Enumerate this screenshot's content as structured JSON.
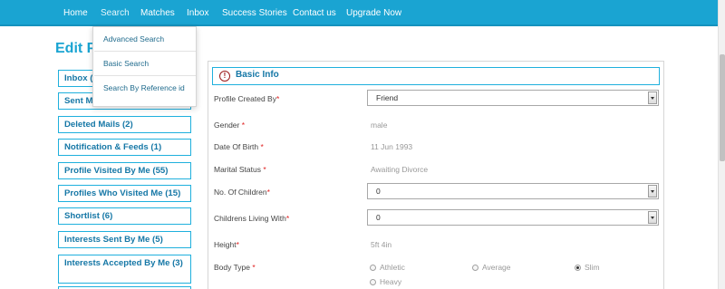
{
  "nav": {
    "items": [
      "Home",
      "Search",
      "Matches",
      "Inbox",
      "Success Stories",
      "Contact us",
      "Upgrade Now"
    ],
    "active_index": 1
  },
  "search_dropdown": {
    "items": [
      "Advanced Search",
      "Basic Search",
      "Search By Reference id"
    ]
  },
  "page": {
    "title": "Edit P"
  },
  "sidebar": {
    "items": [
      {
        "label": "Inbox ("
      },
      {
        "label": "Sent Mails (3)"
      },
      {
        "label": "Deleted Mails (2)"
      },
      {
        "label": "Notification & Feeds (1)"
      },
      {
        "label": "Profile Visited By Me (55)"
      },
      {
        "label": "Profiles Who Visited Me (15)"
      },
      {
        "label": "Shortlist (6)"
      },
      {
        "label": "Interests Sent By Me (5)"
      },
      {
        "label": "Interests Accepted By Me (3)"
      }
    ]
  },
  "basic_info": {
    "title": "Basic Info",
    "profile_created_by": {
      "label": "Profile Created By",
      "value": "Friend"
    },
    "gender": {
      "label": "Gender ",
      "value": "male"
    },
    "dob": {
      "label": "Date Of Birth ",
      "value": "11 Jun 1993"
    },
    "marital_status": {
      "label": "Marital Status ",
      "value": "Awaiting Divorce"
    },
    "children": {
      "label": "No. Of Children",
      "value": "0"
    },
    "children_living": {
      "label": "Childrens Living With",
      "value": "0"
    },
    "height": {
      "label": "Height",
      "value": "5ft 4in"
    },
    "body_type": {
      "label": "Body Type ",
      "options": [
        "Athletic",
        "Average",
        "Slim",
        "Heavy"
      ],
      "selected": "Slim"
    },
    "required_mark": "*"
  },
  "colors": {
    "nav_bg": "#1aa4d2",
    "accent": "#1577a6",
    "required": "#e02020",
    "icon": "#9b1a1a"
  }
}
